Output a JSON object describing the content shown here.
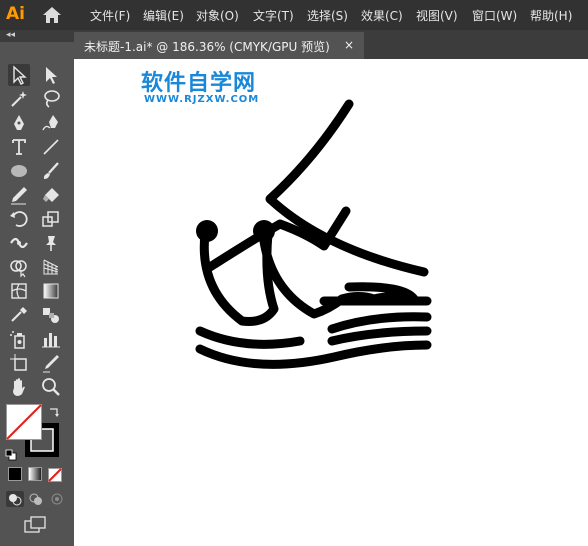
{
  "app": {
    "logo": "Ai"
  },
  "menu": {
    "items": [
      "文件(F)",
      "编辑(E)",
      "对象(O)",
      "文字(T)",
      "选择(S)",
      "效果(C)",
      "视图(V)",
      "窗口(W)",
      "帮助(H)"
    ]
  },
  "document_tab": {
    "title": "未标题-1.ai* @ 186.36% (CMYK/GPU 预览)",
    "close": "×"
  },
  "watermark": {
    "main": "软件自学网",
    "sub": "WWW.RJZXW.COM"
  },
  "colors": {
    "menubar": "#323232",
    "panel": "#535353",
    "canvas": "#ffffff",
    "logo": "#ff9a00",
    "watermark": "#1a88d8"
  },
  "tools": [
    "selection-tool",
    "direct-selection-tool",
    "magic-wand-tool",
    "lasso-tool",
    "pen-tool",
    "curvature-tool",
    "type-tool",
    "line-segment-tool",
    "ellipse-tool",
    "paintbrush-tool",
    "pencil-tool",
    "eraser-tool",
    "rotate-tool",
    "scale-tool",
    "width-tool",
    "puppet-warp-tool",
    "shape-builder-tool",
    "perspective-grid-tool",
    "mesh-tool",
    "gradient-tool",
    "eyedropper-tool",
    "blend-tool",
    "symbol-sprayer-tool",
    "column-graph-tool",
    "artboard-tool",
    "slice-tool",
    "hand-tool",
    "zoom-tool"
  ]
}
